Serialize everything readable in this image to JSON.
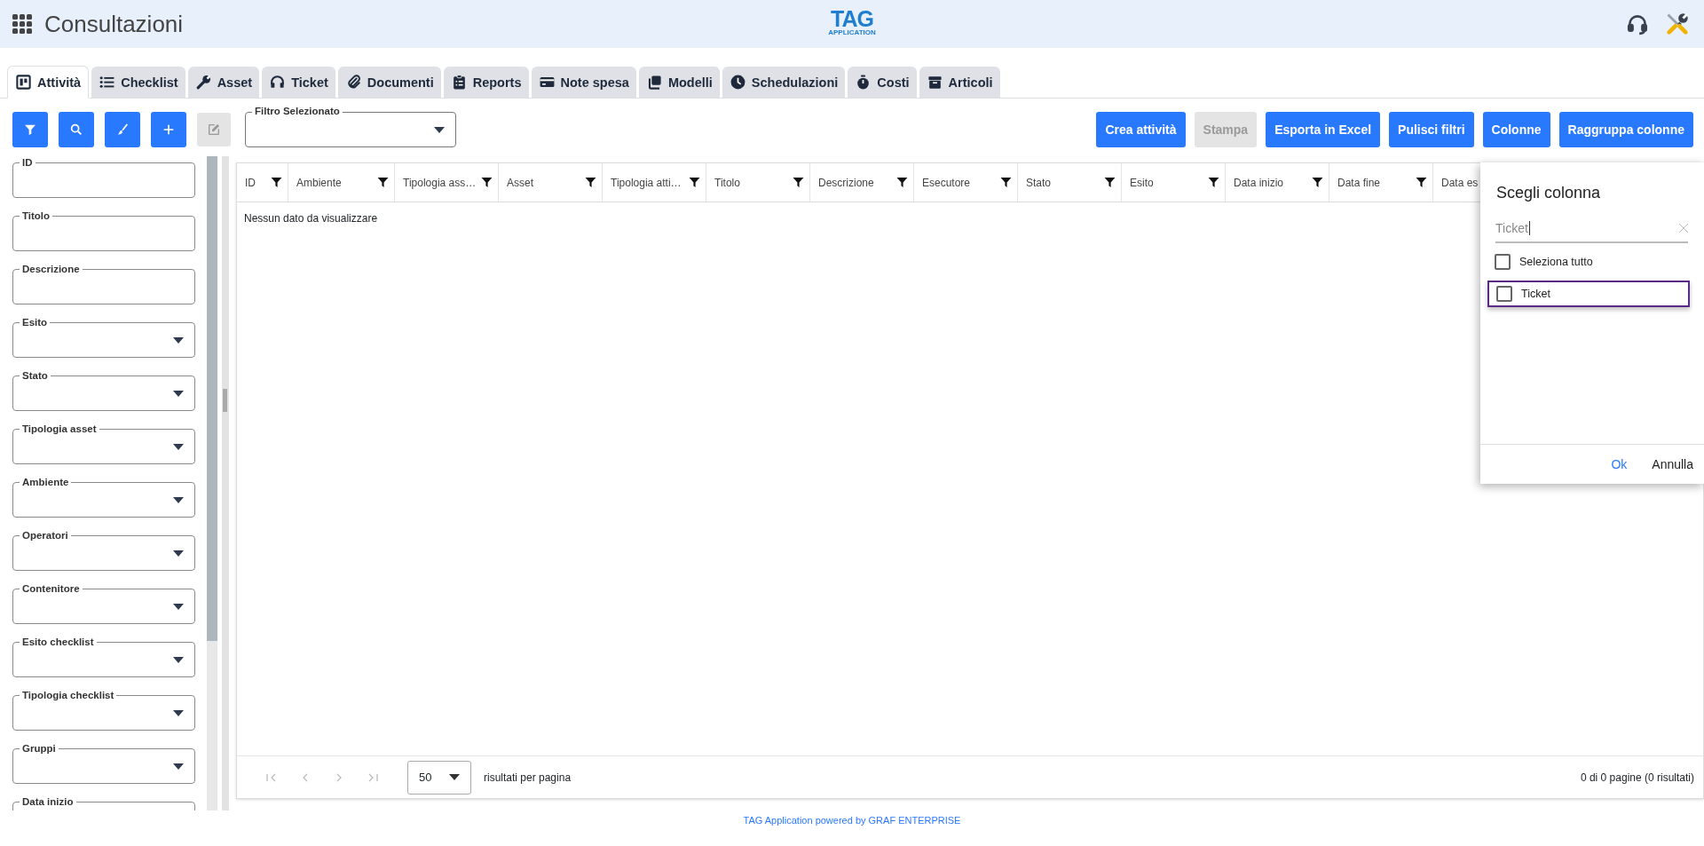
{
  "header": {
    "title": "Consultazioni",
    "logo": {
      "text": "TAG",
      "subtext": "APPLICATION"
    }
  },
  "tabs": [
    {
      "label": "Attività",
      "selected": true
    },
    {
      "label": "Checklist",
      "selected": false
    },
    {
      "label": "Asset",
      "selected": false
    },
    {
      "label": "Ticket",
      "selected": false
    },
    {
      "label": "Documenti",
      "selected": false
    },
    {
      "label": "Reports",
      "selected": false
    },
    {
      "label": "Note spesa",
      "selected": false
    },
    {
      "label": "Modelli",
      "selected": false
    },
    {
      "label": "Schedulazioni",
      "selected": false
    },
    {
      "label": "Costi",
      "selected": false
    },
    {
      "label": "Articoli",
      "selected": false
    }
  ],
  "toolbar": {
    "icon_buttons": [
      {
        "disabled": false
      },
      {
        "disabled": false
      },
      {
        "disabled": false
      },
      {
        "disabled": false
      },
      {
        "disabled": true
      }
    ],
    "filter_select": {
      "label": "Filtro Selezionato"
    },
    "actions": [
      {
        "label": "Crea attività",
        "disabled": false
      },
      {
        "label": "Stampa",
        "disabled": true
      },
      {
        "label": "Esporta in Excel",
        "disabled": false
      },
      {
        "label": "Pulisci filtri",
        "disabled": false
      },
      {
        "label": "Colonne",
        "disabled": false
      },
      {
        "label": "Raggruppa colonne",
        "disabled": false
      }
    ]
  },
  "filters": [
    {
      "label": "ID",
      "kind": "text"
    },
    {
      "label": "Titolo",
      "kind": "text"
    },
    {
      "label": "Descrizione",
      "kind": "text"
    },
    {
      "label": "Esito",
      "kind": "select"
    },
    {
      "label": "Stato",
      "kind": "select"
    },
    {
      "label": "Tipologia asset",
      "kind": "select"
    },
    {
      "label": "Ambiente",
      "kind": "select"
    },
    {
      "label": "Operatori",
      "kind": "select"
    },
    {
      "label": "Contenitore",
      "kind": "select"
    },
    {
      "label": "Esito checklist",
      "kind": "select"
    },
    {
      "label": "Tipologia checklist",
      "kind": "select"
    },
    {
      "label": "Gruppi",
      "kind": "select"
    },
    {
      "label": "Data inizio",
      "kind": "text"
    }
  ],
  "table": {
    "columns": [
      "ID",
      "Ambiente",
      "Tipologia ass…",
      "Asset",
      "Tipologia atti…",
      "Titolo",
      "Descrizione",
      "Esecutore",
      "Stato",
      "Esito",
      "Data inizio",
      "Data fine",
      "Data es"
    ],
    "empty_message": "Nessun dato da visualizzare",
    "pager": {
      "page_size": "50",
      "per_page_label": "risultati per pagina",
      "summary": "0 di 0 pagine (0 risultati)"
    }
  },
  "column_dialog": {
    "title": "Scegli colonna",
    "search": {
      "value": "Ticket"
    },
    "options": [
      {
        "label": "Seleziona tutto",
        "checked": false,
        "focused": false
      },
      {
        "label": "Ticket",
        "checked": false,
        "focused": true
      }
    ],
    "buttons": [
      {
        "label": "Ok",
        "kind": "primary"
      },
      {
        "label": "Annulla",
        "kind": "secondary"
      }
    ]
  },
  "footer": "TAG Application powered by GRAF ENTERPRISE"
}
